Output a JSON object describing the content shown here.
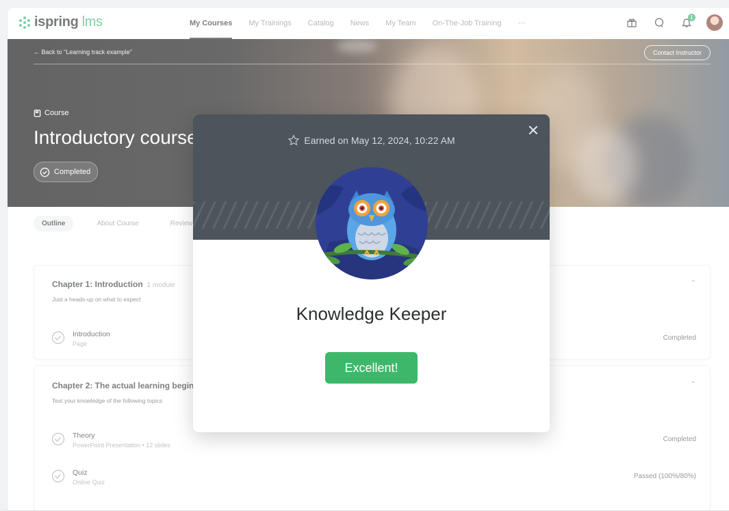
{
  "brand": {
    "name": "ispring",
    "suffix": "lms"
  },
  "nav": {
    "links": [
      "My Courses",
      "My Trainings",
      "Catalog",
      "News",
      "My Team",
      "On-The-Job Training",
      "⋯"
    ],
    "notification_count": "1"
  },
  "hero": {
    "back_link": "←  Back to \"Learning track example\"",
    "contact_button": "Contact Instructor",
    "type_label": "Course",
    "title": "Introductory course",
    "status": "Completed"
  },
  "tabs": [
    "Outline",
    "About Course",
    "Reviews"
  ],
  "chapters": [
    {
      "title": "Chapter 1: Introduction",
      "meta": "1 module",
      "subtitle": "Just a heads-up on what to expect",
      "items": [
        {
          "title": "Introduction",
          "type": "Page",
          "status": "Completed"
        }
      ]
    },
    {
      "title": "Chapter 2: The actual learning begins",
      "subtitle": "Test your knowledge of the following topics",
      "items": [
        {
          "title": "Theory",
          "type": "PowerPoint Presentation  •  12 slides",
          "status": "Completed"
        },
        {
          "title": "Quiz",
          "type": "Online Quiz",
          "status": "Passed (100%/80%)"
        }
      ]
    }
  ],
  "modal": {
    "earned": "Earned on May 12, 2024, 10:22 AM",
    "badge_name": "Knowledge Keeper",
    "button": "Excellent!",
    "header_color": "#4c545c",
    "button_color": "#3db86b"
  }
}
